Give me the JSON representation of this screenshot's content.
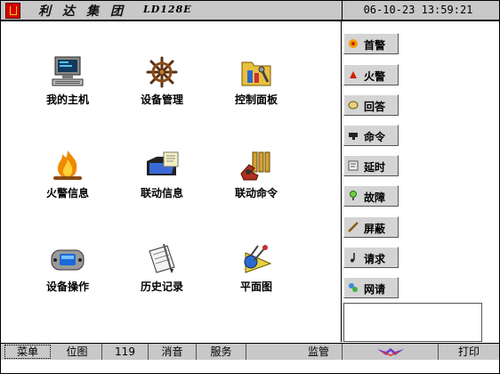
{
  "titlebar": {
    "brand": [
      "利",
      "达",
      "集",
      "团"
    ],
    "model": "LD128E",
    "datetime": "06-10-23 13:59:21"
  },
  "main": {
    "tiles": [
      {
        "label": "我的主机",
        "icon": "computer-icon"
      },
      {
        "label": "设备管理",
        "icon": "ship-wheel-icon"
      },
      {
        "label": "控制面板",
        "icon": "control-panel-folder-icon"
      },
      {
        "label": "火警信息",
        "icon": "fire-icon"
      },
      {
        "label": "联动信息",
        "icon": "linkage-folder-icon"
      },
      {
        "label": "联动命令",
        "icon": "linkage-command-icon"
      },
      {
        "label": "设备操作",
        "icon": "gamepad-icon"
      },
      {
        "label": "历史记录",
        "icon": "history-pen-icon"
      },
      {
        "label": "平面图",
        "icon": "floor-plan-icon"
      }
    ]
  },
  "side": {
    "buttons": [
      {
        "label": "首警",
        "icon": "first-alarm-icon"
      },
      {
        "label": "火警",
        "icon": "fire-alarm-icon"
      },
      {
        "label": "回答",
        "icon": "answer-icon"
      },
      {
        "label": "命令",
        "icon": "command-icon"
      },
      {
        "label": "延时",
        "icon": "delay-icon"
      },
      {
        "label": "故障",
        "icon": "fault-icon"
      },
      {
        "label": "屏蔽",
        "icon": "shield-icon"
      },
      {
        "label": "请求",
        "icon": "request-icon"
      },
      {
        "label": "网请",
        "icon": "network-request-icon"
      }
    ]
  },
  "bottom": {
    "menu": "菜单",
    "map": "位图",
    "num": "119",
    "mute": "消音",
    "service": "服务",
    "monitor": "监管",
    "print": "打印"
  },
  "colors": {
    "chrome": "#c8c8c8",
    "button": "#d4d4d4",
    "brand_red": "#d40000",
    "fire_orange": "#f08a00"
  }
}
